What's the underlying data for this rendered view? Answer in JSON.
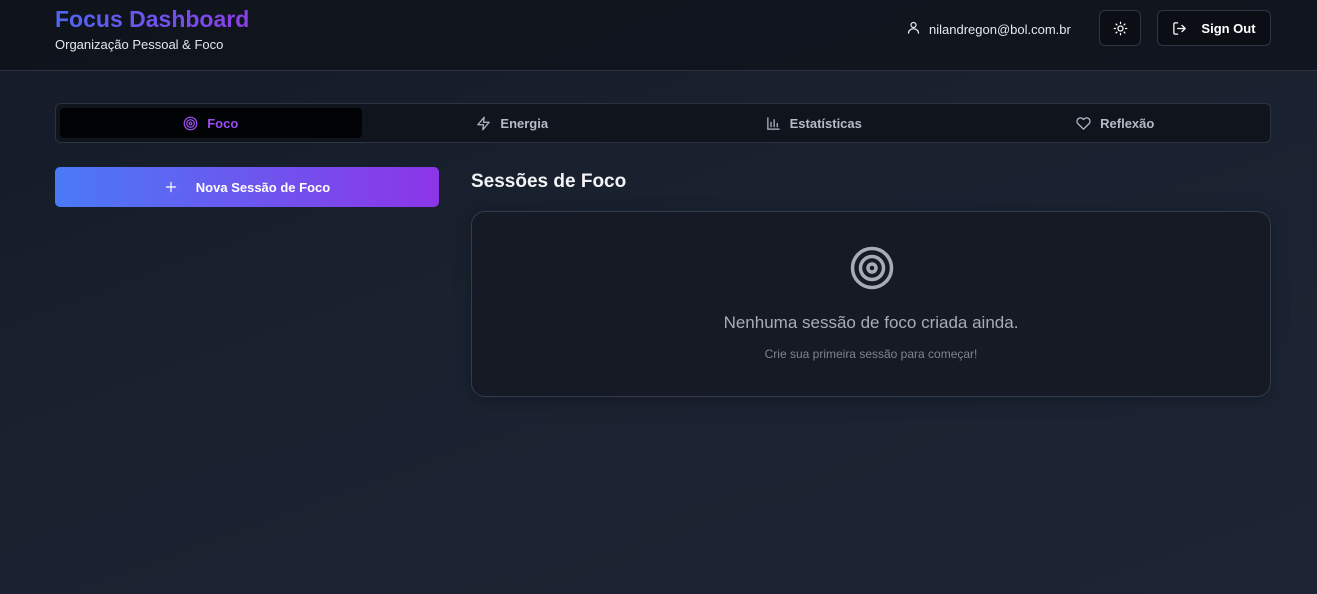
{
  "header": {
    "title": "Focus Dashboard",
    "subtitle": "Organização Pessoal & Foco",
    "user_email": "nilandregon@bol.com.br",
    "sign_out_label": "Sign Out"
  },
  "tabs": [
    {
      "label": "Foco",
      "icon": "target-icon",
      "active": true
    },
    {
      "label": "Energia",
      "icon": "zap-icon",
      "active": false
    },
    {
      "label": "Estatísticas",
      "icon": "bar-chart-icon",
      "active": false
    },
    {
      "label": "Reflexão",
      "icon": "heart-icon",
      "active": false
    }
  ],
  "sidebar": {
    "new_session_label": "Nova Sessão de Foco"
  },
  "main": {
    "section_title": "Sessões de Foco",
    "empty_message": "Nenhuma sessão de foco criada ainda.",
    "empty_hint": "Crie sua primeira sessão para começar!"
  },
  "colors": {
    "accent_purple": "#9a4cf0",
    "gradient_start": "#4a7af6",
    "gradient_end": "#8d35e8"
  }
}
